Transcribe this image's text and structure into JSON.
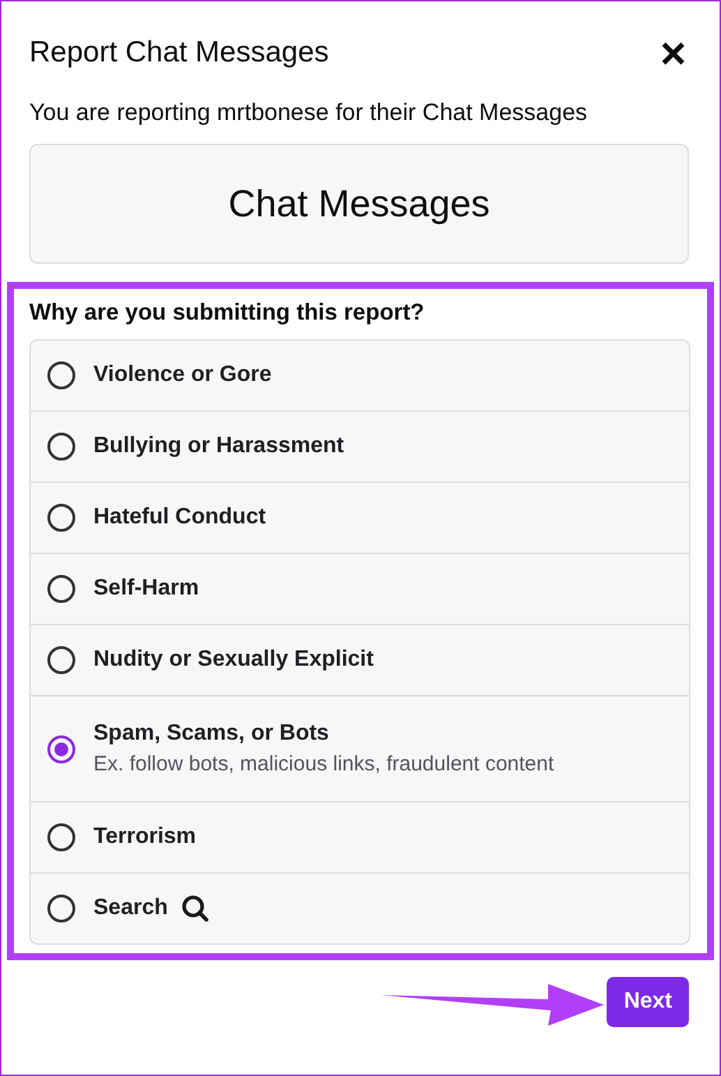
{
  "dialog": {
    "title": "Report Chat Messages",
    "close": "×"
  },
  "subtitle": "You are reporting mrtbonese for their Chat Messages",
  "category": "Chat Messages",
  "question": "Why are you submitting this report?",
  "options": [
    {
      "label": "Violence or Gore",
      "selected": false,
      "kind": "plain"
    },
    {
      "label": "Bullying or Harassment",
      "selected": false,
      "kind": "plain"
    },
    {
      "label": "Hateful Conduct",
      "selected": false,
      "kind": "plain"
    },
    {
      "label": "Self-Harm",
      "selected": false,
      "kind": "plain"
    },
    {
      "label": "Nudity or Sexually Explicit",
      "selected": false,
      "kind": "plain"
    },
    {
      "label": "Spam, Scams, or Bots",
      "description": "Ex. follow bots, malicious links, fraudulent content",
      "selected": true,
      "kind": "plain"
    },
    {
      "label": "Terrorism",
      "selected": false,
      "kind": "plain"
    },
    {
      "label": "Search",
      "selected": false,
      "kind": "search"
    }
  ],
  "next_button": "Next"
}
